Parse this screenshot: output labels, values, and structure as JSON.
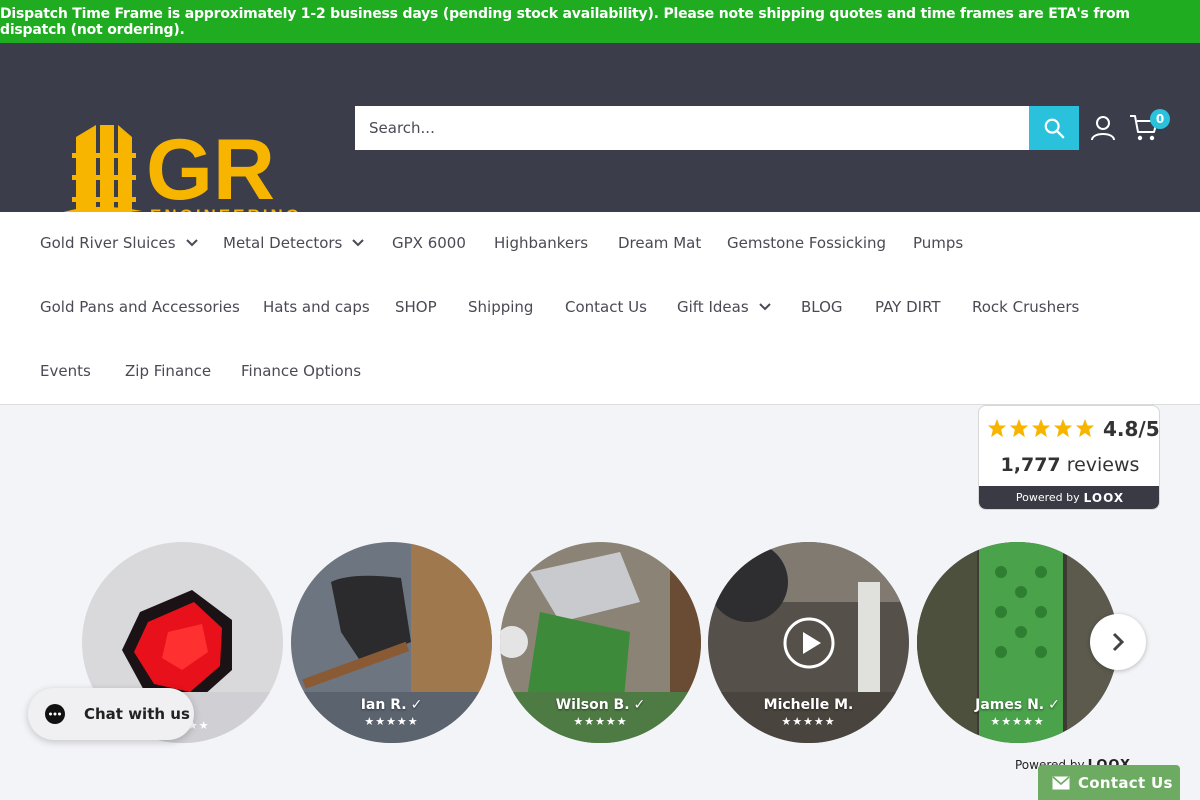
{
  "announcement": "Dispatch Time Frame is approximately 1-2 business days (pending stock availability). Please note shipping quotes and time frames are ETA's from dispatch (not ordering).",
  "brand": {
    "logo_text": "GR",
    "logo_subtext": "ENGINEERING",
    "logo_color": "#f7b500"
  },
  "colors": {
    "announce_bg": "#1fac20",
    "header_bg": "#3b3d4a",
    "accent": "#2ac1dc",
    "star": "#f7b500",
    "contact_bg": "#6dab62"
  },
  "search": {
    "placeholder": "Search...",
    "icon": "search-icon"
  },
  "header_icons": {
    "account": "account-icon",
    "cart": "cart-icon",
    "cart_count": "0"
  },
  "nav": {
    "items": [
      {
        "label": "Gold River Sluices",
        "has_dropdown": true
      },
      {
        "label": "Metal Detectors",
        "has_dropdown": true
      },
      {
        "label": "GPX 6000",
        "has_dropdown": false
      },
      {
        "label": "Highbankers",
        "has_dropdown": false
      },
      {
        "label": "Dream Mat",
        "has_dropdown": false
      },
      {
        "label": "Gemstone Fossicking",
        "has_dropdown": false
      },
      {
        "label": "Pumps",
        "has_dropdown": false
      },
      {
        "label": "Gold Pans and Accessories",
        "has_dropdown": false
      },
      {
        "label": "Hats and caps",
        "has_dropdown": false
      },
      {
        "label": "SHOP",
        "has_dropdown": false
      },
      {
        "label": "Shipping",
        "has_dropdown": false
      },
      {
        "label": "Contact Us",
        "has_dropdown": false
      },
      {
        "label": "Gift Ideas",
        "has_dropdown": true
      },
      {
        "label": "BLOG",
        "has_dropdown": false
      },
      {
        "label": "PAY DIRT",
        "has_dropdown": false
      },
      {
        "label": "Rock Crushers",
        "has_dropdown": false
      },
      {
        "label": "Events",
        "has_dropdown": false
      },
      {
        "label": "Zip Finance",
        "has_dropdown": false
      },
      {
        "label": "Finance Options",
        "has_dropdown": false
      }
    ]
  },
  "loox": {
    "rating": "4.8/5",
    "stars": 5,
    "count": "1,777",
    "count_label": "reviews",
    "powered_by": "Powered by",
    "brand": "LOOX"
  },
  "reviews": [
    {
      "name": "",
      "stars": "★★★★★",
      "has_video": false
    },
    {
      "name": "Ian R.",
      "stars": "★★★★★",
      "has_video": false
    },
    {
      "name": "Wilson B.",
      "stars": "★★★★★",
      "has_video": false
    },
    {
      "name": "Michelle M.",
      "stars": "★★★★★",
      "has_video": true
    },
    {
      "name": "James N.",
      "stars": "★★★★★",
      "has_video": false
    }
  ],
  "powered_footer": {
    "text": "Powered by",
    "brand": "LOOX"
  },
  "chat": {
    "label": "Chat with us"
  },
  "contact": {
    "label": "Contact Us"
  }
}
